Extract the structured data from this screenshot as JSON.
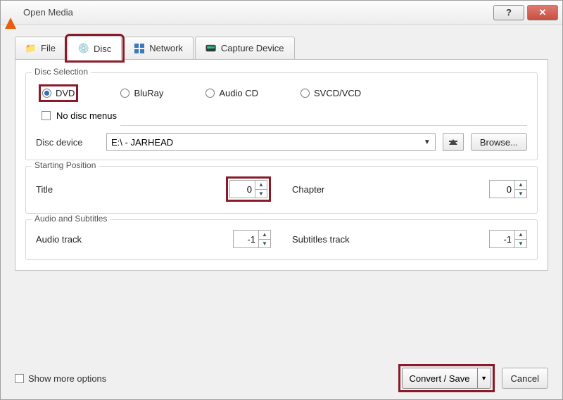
{
  "window": {
    "title": "Open Media"
  },
  "tabs": {
    "file": "File",
    "disc": "Disc",
    "network": "Network",
    "capture": "Capture Device"
  },
  "disc_selection": {
    "legend": "Disc Selection",
    "dvd": "DVD",
    "bluray": "BluRay",
    "audiocd": "Audio CD",
    "svcd": "SVCD/VCD",
    "no_menus": "No disc menus",
    "disc_device_label": "Disc device",
    "disc_device_value": "E:\\ - JARHEAD",
    "browse": "Browse..."
  },
  "starting_position": {
    "legend": "Starting Position",
    "title_label": "Title",
    "title_value": "0",
    "chapter_label": "Chapter",
    "chapter_value": "0"
  },
  "audio_subtitles": {
    "legend": "Audio and Subtitles",
    "audio_label": "Audio track",
    "audio_value": "-1",
    "subs_label": "Subtitles track",
    "subs_value": "-1"
  },
  "footer": {
    "show_more": "Show more options",
    "convert": "Convert / Save",
    "cancel": "Cancel"
  }
}
